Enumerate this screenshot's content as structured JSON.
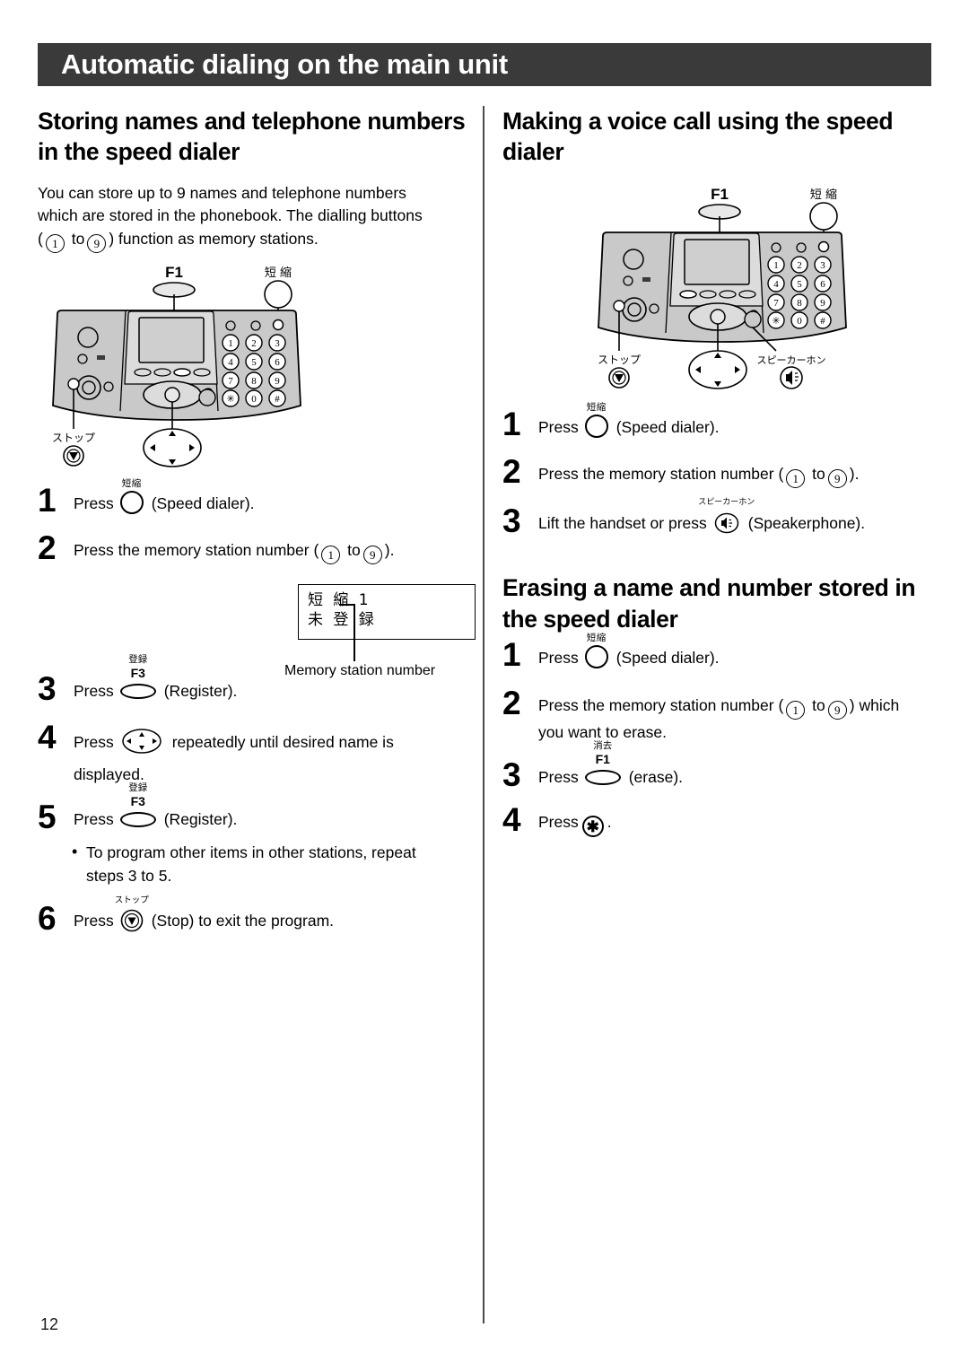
{
  "header": {
    "title": "Automatic dialing on the main unit"
  },
  "page_number": "12",
  "left": {
    "heading": "Storing names and telephone numbers in the speed dialer",
    "intro_line1": "You can store up to 9 names and telephone numbers",
    "intro_line2": "which are stored in the phonebook. The dialling buttons",
    "intro_line3_pre": "(",
    "intro_digit_from": "1",
    "intro_mid": "to",
    "intro_digit_to": "9",
    "intro_line3_post": ") function as memory stations.",
    "steps": [
      {
        "num": "1",
        "pre": "Press",
        "key_caption": "短縮",
        "key_type": "round",
        "post": "(Speed dialer)."
      },
      {
        "num": "2",
        "pre": "Press the memory station number (",
        "digit_from": "1",
        "mid": "to",
        "digit_to": "9",
        "post": ")."
      },
      {
        "num": "3",
        "pre": "Press",
        "key_caption": "登録",
        "key_label": "F3",
        "key_type": "fkey",
        "post": "(Register)."
      },
      {
        "num": "4",
        "pre": "Press",
        "key_type": "nav",
        "post": "repeatedly until desired name is",
        "cont": "displayed."
      },
      {
        "num": "5",
        "pre": "Press",
        "key_caption": "登録",
        "key_label": "F3",
        "key_type": "fkey",
        "post": "(Register)."
      },
      {
        "num": "6",
        "pre": "Press",
        "key_caption": "ストップ",
        "key_type": "stop",
        "post": "(Stop) to exit the program."
      }
    ],
    "bullet_line1": "To program other items in other stations, repeat",
    "bullet_line2": "steps 3 to 5.",
    "lcd": {
      "line1": "短 縮 1",
      "line2": "未 登 録",
      "caption": "Memory station number"
    },
    "diagram": {
      "f1_label": "F1",
      "speed_label": "短縮",
      "stop_label": "ストップ",
      "keypad": [
        "1",
        "2",
        "3",
        "4",
        "5",
        "6",
        "7",
        "8",
        "9",
        "*",
        "0",
        "#"
      ]
    }
  },
  "right": {
    "heading_voice": "Making a voice call using the speed dialer",
    "heading_erase": "Erasing a name and number stored in the speed dialer",
    "diagram": {
      "f1_label": "F1",
      "speed_label": "短縮",
      "stop_label": "ストップ",
      "speaker_label": "スピーカーホン",
      "keypad": [
        "1",
        "2",
        "3",
        "4",
        "5",
        "6",
        "7",
        "8",
        "9",
        "*",
        "0",
        "#"
      ]
    },
    "voice_steps": [
      {
        "num": "1",
        "pre": "Press",
        "key_caption": "短縮",
        "key_type": "round",
        "post": "(Speed dialer)."
      },
      {
        "num": "2",
        "pre": "Press the memory station number (",
        "digit_from": "1",
        "mid": "to",
        "digit_to": "9",
        "post": ")."
      },
      {
        "num": "3",
        "pre": "Lift the handset or press",
        "key_caption": "スピーカーホン",
        "key_type": "speaker",
        "post": "(Speakerphone)."
      }
    ],
    "erase_steps": [
      {
        "num": "1",
        "pre": "Press",
        "key_caption": "短縮",
        "key_type": "round",
        "post": "(Speed dialer)."
      },
      {
        "num": "2",
        "pre": "Press the memory station number (",
        "digit_from": "1",
        "mid": "to",
        "digit_to": "9",
        "post": ") which",
        "cont": "you want to erase."
      },
      {
        "num": "3",
        "pre": "Press",
        "key_caption": "消去",
        "key_label": "F1",
        "key_type": "fkey",
        "post": "(erase)."
      },
      {
        "num": "4",
        "pre": "Press",
        "key_type": "star",
        "star_glyph": "✱",
        "post": "."
      }
    ]
  },
  "colors": {
    "header_bar": "#3a3a3a",
    "panel_body": "#c9c9c9",
    "panel_light": "#e2e2e2"
  }
}
